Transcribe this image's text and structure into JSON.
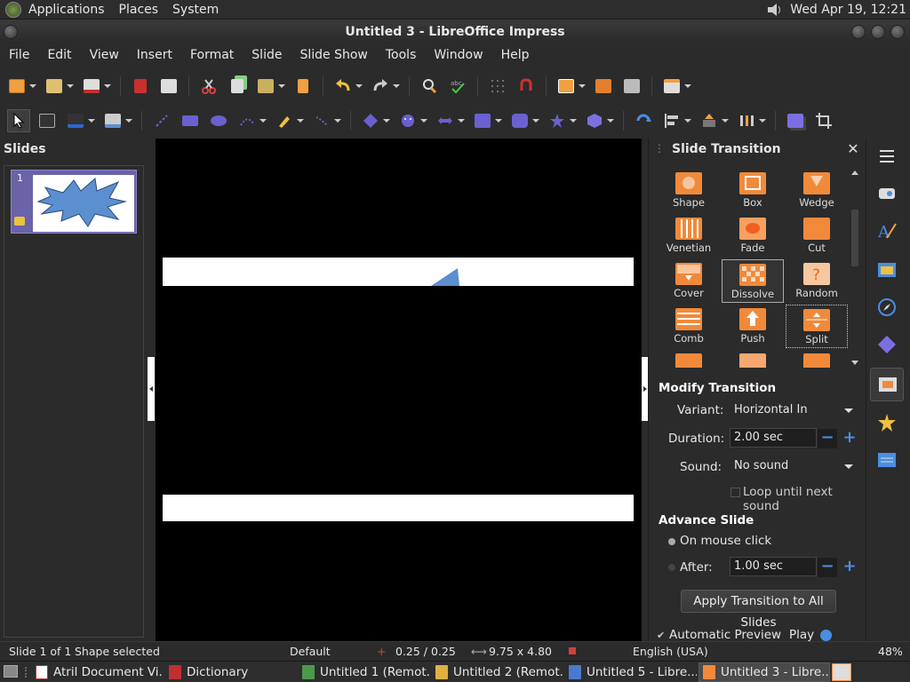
{
  "top_panel": {
    "menus": [
      "Applications",
      "Places",
      "System"
    ],
    "clock": "Wed Apr 19, 12:21"
  },
  "window": {
    "title": "Untitled 3 - LibreOffice Impress"
  },
  "menubar": [
    "File",
    "Edit",
    "View",
    "Insert",
    "Format",
    "Slide",
    "Slide Show",
    "Tools",
    "Window",
    "Help"
  ],
  "slides_pane": {
    "title": "Slides",
    "slide_number": "1"
  },
  "sidebar": {
    "title": "Slide Transition",
    "transitions": [
      {
        "label": "Shape"
      },
      {
        "label": "Box"
      },
      {
        "label": "Wedge"
      },
      {
        "label": "Venetian"
      },
      {
        "label": "Fade"
      },
      {
        "label": "Cut"
      },
      {
        "label": "Cover"
      },
      {
        "label": "Dissolve"
      },
      {
        "label": "Random"
      },
      {
        "label": "Comb"
      },
      {
        "label": "Push"
      },
      {
        "label": "Split"
      }
    ],
    "selected_transition": "Dissolve",
    "focused_transition": "Split",
    "modify": {
      "heading": "Modify Transition",
      "variant_label": "Variant:",
      "variant_value": "Horizontal In",
      "duration_label": "Duration:",
      "duration_value": "2.00 sec",
      "sound_label": "Sound:",
      "sound_value": "No sound",
      "loop_label": "Loop until next sound"
    },
    "advance": {
      "heading": "Advance Slide",
      "on_click_label": "On mouse click",
      "after_label": "After:",
      "after_value": "1.00 sec"
    },
    "apply_all_label": "Apply Transition to All Slides",
    "auto_preview_label": "Automatic Preview",
    "play_label": "Play"
  },
  "statusbar": {
    "slide_info": "Slide 1 of 1",
    "selection": "Shape selected",
    "layout": "Default",
    "position": "0.25 / 0.25",
    "size": "9.75 x 4.80",
    "language": "English (USA)",
    "zoom": "48%"
  },
  "taskbar": {
    "tasks": [
      {
        "label": "Atril Document Vi..."
      },
      {
        "label": "Dictionary"
      },
      {
        "label": "Untitled 1 (Remot..."
      },
      {
        "label": "Untitled 2 (Remot..."
      },
      {
        "label": "Untitled 5 - Libre..."
      },
      {
        "label": "Untitled 3 - Libre..."
      }
    ]
  },
  "colors": {
    "accent_orange": "#f08a3a",
    "selection_purple": "#6a63a8",
    "spin_blue": "#4a8ee0",
    "shape_blue": "#5b8fd0"
  }
}
